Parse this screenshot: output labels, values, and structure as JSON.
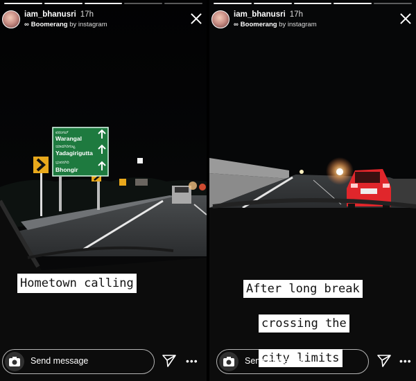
{
  "stories": [
    {
      "username": "iam_bhanusri",
      "time": "17h",
      "boomerang_label": "Boomerang",
      "by_label": "by instagram",
      "caption_lines": [
        "Hometown calling"
      ],
      "sign_lines": [
        "Warangal",
        "Yadagirigutta",
        "Bhongir"
      ],
      "reply_placeholder": "Send message",
      "icons": [
        "camera-icon",
        "send-icon",
        "more-icon",
        "close-icon",
        "boomerang-icon"
      ]
    },
    {
      "username": "iam_bhanusri",
      "time": "17h",
      "boomerang_label": "Boomerang",
      "by_label": "by instagram",
      "caption_lines": [
        "After long break",
        "crossing the",
        "city limits"
      ],
      "reply_placeholder": "Send message",
      "icons": [
        "camera-icon",
        "send-icon",
        "more-icon",
        "close-icon",
        "boomerang-icon"
      ]
    }
  ],
  "colors": {
    "sign_green": "#1e7a3f",
    "taillight_red": "#e0262b"
  }
}
